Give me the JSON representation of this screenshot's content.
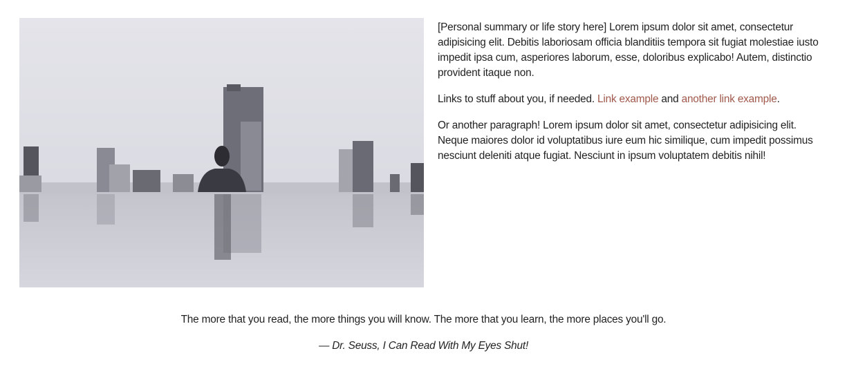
{
  "bio": {
    "paragraph1": "[Personal summary or life story here] Lorem ipsum dolor sit amet, consectetur adipisicing elit. Debitis laboriosam officia blanditiis tempora sit fugiat molestiae iusto impedit ipsa cum, asperiores laborum, esse, doloribus explicabo! Autem, distinctio provident itaque non.",
    "links_intro": "Links to stuff about you, if needed. ",
    "link1_label": "Link example",
    "links_and": " and ",
    "link2_label": "another link example",
    "links_end": ".",
    "paragraph3": "Or another paragraph! Lorem ipsum dolor sit amet, consectetur adipisicing elit. Neque maiores dolor id voluptatibus iure eum hic similique, cum impedit possimus nesciunt deleniti atque fugiat. Nesciunt in ipsum voluptatem debitis nihil!"
  },
  "quote": {
    "text": "The more that you read, the more things you will know. The more that you learn, the more places you'll go.",
    "attribution": "— Dr. Seuss, I Can Read With My Eyes Shut!"
  },
  "colors": {
    "link": "#a0584b",
    "text": "#222222"
  }
}
